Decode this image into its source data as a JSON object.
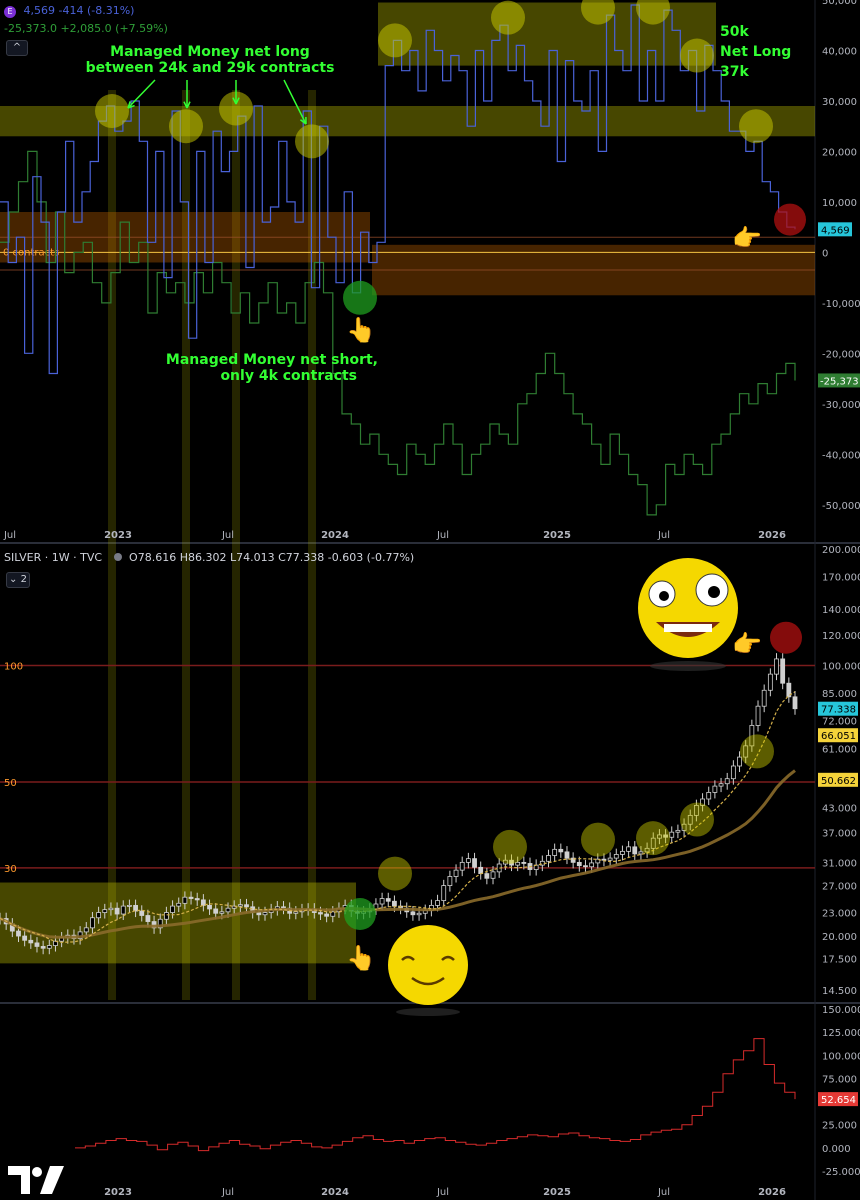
{
  "header": {
    "cot_icon_letter": "E",
    "cot_line1": "4,569  -414 (-8.31%)",
    "cot_line2": "-25,373.0  +2,085.0 (+7.59%)",
    "collapse_glyph": "^",
    "silver_symbol": "SILVER · 1W · TVC",
    "silver_ohlc": "O78.616  H86.302  L74.013  C77.338  -0.603 (-0.77%)",
    "pane_count": "2",
    "pane_toggle_glyph": "⌄"
  },
  "colors": {
    "background": "#000000",
    "mm_net_line": "#4a62d8",
    "second_cot_line": "#2f7d32",
    "silver_candles": "#d0d0d0",
    "ma_fast": "#d4b04a",
    "ma_slow": "#8a6a2a",
    "bottom_line": "#d62b2b",
    "zone_yellow": "#cccc00",
    "zone_orange": "#cc6600",
    "annotation_green": "#33ff33",
    "zero_line": "#f5c542",
    "level_line": "#7a1c1c"
  },
  "annotations": {
    "mm_long_line1": "Managed Money net long",
    "mm_long_line2": "between 24k and 29k contracts",
    "mm_short_line1": "Managed Money net short,",
    "mm_short_line2": "only 4k contracts",
    "right_note_line1": "50k",
    "right_note_line2": "Net Long",
    "right_note_line3": "37k",
    "zero_label": "0 contracts",
    "level_100": "100",
    "level_50": "50",
    "level_30": "30"
  },
  "chart_data": [
    {
      "type": "line",
      "title": "",
      "x_ticks": [
        "Jul",
        "2023",
        "Jul",
        "2024",
        "Jul",
        "2025",
        "Jul",
        "2026"
      ],
      "y_ticks": [
        "50,000",
        "40,000",
        "30,000",
        "20,000",
        "10,000",
        "0",
        "-10,000",
        "-20,000",
        "-30,000",
        "-40,000",
        "-50,000"
      ],
      "ylim": [
        -55000,
        50000
      ],
      "series": [
        {
          "values": [
            10000,
            -2000,
            3000,
            -20000,
            15000,
            6000,
            -24000,
            8000,
            22000,
            6000,
            12000,
            18000,
            26000,
            29000,
            24000,
            26000,
            30000,
            22000,
            2000,
            20000,
            -5000,
            28000,
            10000,
            -17000,
            20000,
            -2000,
            24000,
            16000,
            20000,
            27000,
            -3000,
            29000,
            6000,
            9000,
            22000,
            10000,
            6000,
            28000,
            -7000,
            25000,
            3000,
            -6000,
            12000,
            -8000,
            4000,
            -2000,
            2000,
            37000,
            42000,
            36000,
            40000,
            32000,
            44000,
            40000,
            34000,
            39000,
            36000,
            25000,
            40000,
            30000,
            42000,
            45000,
            36000,
            41000,
            34000,
            30000,
            25000,
            40000,
            18000,
            38000,
            30000,
            28000,
            36000,
            20000,
            47000,
            40000,
            36000,
            49000,
            30000,
            40000,
            30000,
            48000,
            44000,
            36000,
            40000,
            28000,
            41000,
            36000,
            30000,
            24000,
            24000,
            20000,
            22000,
            14000,
            12000,
            8000,
            5000,
            4569
          ],
          "last_value_label": "4,569"
        },
        {
          "values": [
            2000,
            8000,
            14000,
            20000,
            10000,
            -2000,
            8000,
            -4000,
            0,
            2000,
            -6000,
            -10000,
            -4000,
            6000,
            -2000,
            2000,
            -12000,
            -4000,
            -8000,
            -6000,
            -10000,
            -4000,
            -8000,
            -2000,
            -6000,
            -12000,
            -8000,
            -14000,
            -10000,
            -6000,
            -12000,
            -10000,
            -14000,
            -6000,
            -2000,
            -8000,
            -24000,
            -32000,
            -34000,
            -38000,
            -36000,
            -40000,
            -42000,
            -44000,
            -38000,
            -40000,
            -42000,
            -38000,
            -34000,
            -38000,
            -44000,
            -40000,
            -38000,
            -34000,
            -36000,
            -38000,
            -30000,
            -28000,
            -24000,
            -20000,
            -24000,
            -28000,
            -32000,
            -34000,
            -38000,
            -42000,
            -36000,
            -40000,
            -44000,
            -46000,
            -52000,
            -50000,
            -42000,
            -44000,
            -40000,
            -42000,
            -44000,
            -38000,
            -36000,
            -32000,
            -28000,
            -30000,
            -26000,
            -28000,
            -24000,
            -22000,
            -25373
          ],
          "last_value_label": "-25,373"
        }
      ]
    },
    {
      "type": "candlestick",
      "title": "",
      "x_ticks": [
        "2023",
        "Jul",
        "2024",
        "Jul",
        "2025",
        "Jul",
        "2026"
      ],
      "y_ticks": [
        "200.000",
        "170.000",
        "140.000",
        "120.000",
        "100.000",
        "85.000",
        "72.000",
        "61.000",
        "50.000",
        "43.000",
        "37.000",
        "31.000",
        "27.000",
        "23.000",
        "20.000",
        "17.500",
        "14.500"
      ],
      "log_scale": true,
      "ylim": [
        14,
        200
      ],
      "close": [
        22.2,
        21.5,
        20.6,
        20.0,
        19.5,
        19.2,
        18.8,
        18.6,
        18.9,
        19.4,
        19.8,
        20.1,
        19.7,
        20.5,
        21.0,
        22.3,
        23.0,
        23.4,
        23.6,
        22.8,
        23.9,
        24.0,
        23.2,
        22.6,
        21.8,
        21.0,
        22.1,
        23.0,
        23.9,
        24.3,
        25.2,
        25.0,
        24.8,
        24.0,
        23.5,
        22.9,
        23.1,
        23.6,
        23.9,
        24.1,
        23.8,
        23.0,
        22.7,
        23.0,
        23.4,
        23.8,
        23.6,
        22.9,
        23.1,
        23.4,
        23.5,
        23.0,
        22.8,
        22.5,
        23.1,
        23.6,
        24.0,
        23.2,
        22.9,
        23.1,
        23.5,
        24.2,
        25.0,
        24.6,
        23.9,
        23.6,
        23.1,
        22.7,
        22.9,
        23.3,
        24.0,
        24.7,
        27.0,
        28.5,
        29.6,
        31.0,
        31.7,
        30.1,
        29.0,
        28.2,
        29.3,
        30.7,
        31.4,
        30.5,
        31.0,
        30.8,
        29.7,
        30.5,
        31.2,
        32.3,
        33.5,
        33.0,
        31.8,
        31.0,
        30.4,
        30.2,
        30.9,
        31.6,
        31.4,
        31.8,
        32.5,
        33.1,
        34.0,
        32.6,
        33.0,
        33.7,
        35.8,
        36.5,
        36.0,
        37.1,
        37.5,
        38.9,
        41.0,
        43.5,
        45.2,
        47.0,
        48.8,
        49.5,
        51.0,
        55.0,
        58.0,
        62.0,
        70.0,
        78.5,
        86.3,
        95.0,
        104.0,
        90.0,
        83.0,
        77.338
      ],
      "ma_fast_last": 66.051,
      "ma_slow_last": 50.662,
      "levels": [
        100,
        50,
        30
      ],
      "last_value_label": "77.338",
      "ma_fast_label": "66.051",
      "ma_slow_label": "50.662"
    },
    {
      "type": "line",
      "title": "",
      "x_ticks": [
        "2023",
        "Jul",
        "2024",
        "Jul",
        "2025",
        "Jul",
        "2026"
      ],
      "y_ticks": [
        "150.000",
        "125.000",
        "100.000",
        "75.000",
        "50.000",
        "25.000",
        "0.000",
        "-25.000"
      ],
      "ylim": [
        -25,
        150
      ],
      "series": [
        {
          "values": [
            0,
            2,
            5,
            8,
            10,
            8,
            7,
            3,
            -2,
            4,
            6,
            2,
            -3,
            1,
            5,
            8,
            4,
            2,
            -1,
            3,
            6,
            8,
            5,
            1,
            0,
            3,
            7,
            11,
            13,
            9,
            7,
            8,
            5,
            8,
            10,
            11,
            8,
            6,
            4,
            3,
            5,
            8,
            10,
            12,
            14,
            13,
            12,
            15,
            16,
            13,
            11,
            10,
            8,
            7,
            9,
            14,
            17,
            19,
            20,
            25,
            35,
            45,
            60,
            80,
            95,
            105,
            118,
            90,
            70,
            60,
            52.654
          ],
          "last_value_label": "52.654"
        }
      ]
    }
  ]
}
